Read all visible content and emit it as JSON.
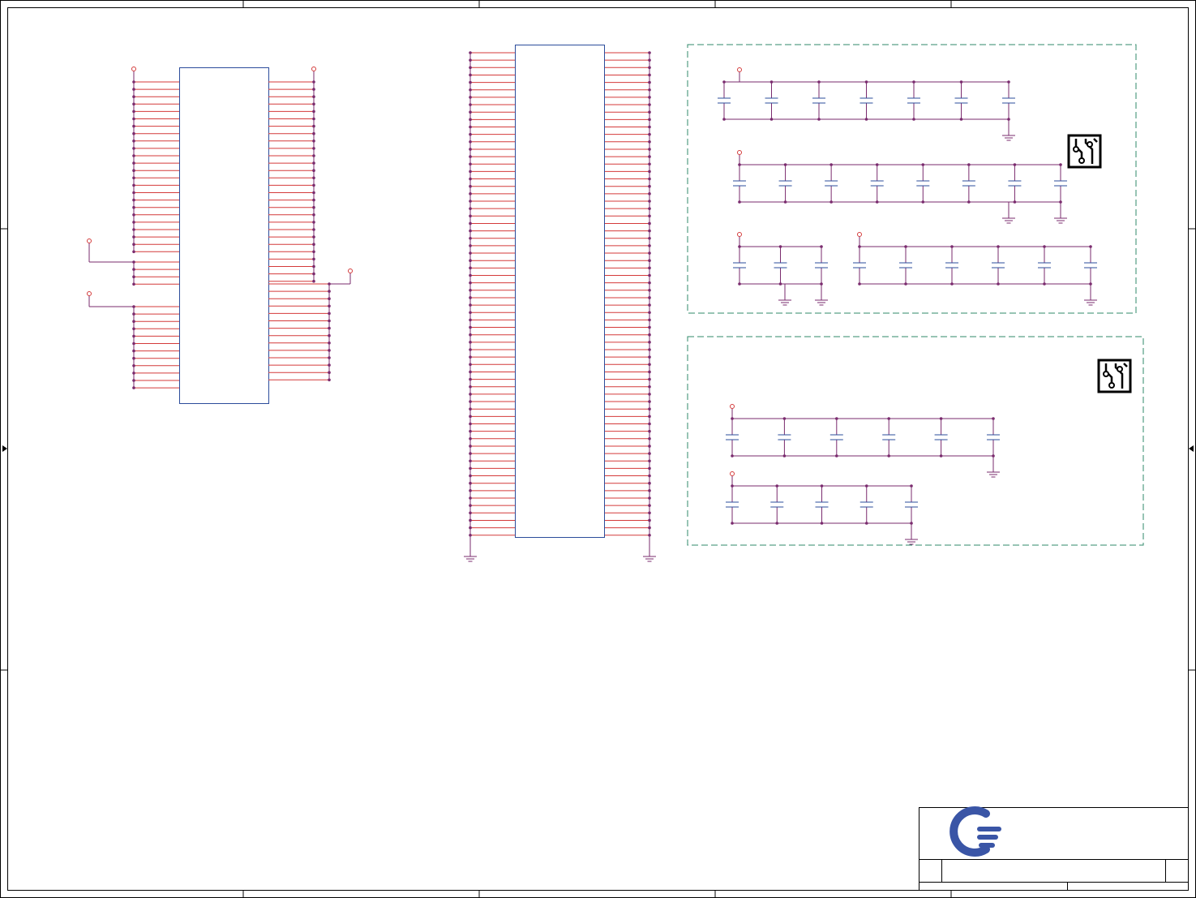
{
  "colors": {
    "frame": "#000000",
    "wire": "#7a2b6e",
    "pin": "#d43a3a",
    "part": "#2b4c9b",
    "box": "#2f8a6a",
    "logo": "#3a55a6",
    "ic": "#000000"
  },
  "drawing": {
    "chip_left_pins_top_group": 24,
    "chip_left_pins_mid_group": 4,
    "chip_left_pins_bottom_group": 12,
    "chip_right_pins_top_group": 28,
    "chip_right_pins_bottom_group": 14,
    "connector_pins_per_side": 66
  },
  "decoupling_blocks": [
    {
      "name": "block-1",
      "rows": [
        {
          "caps": 7,
          "grounds": 1
        },
        {
          "caps": 8,
          "grounds": 2
        },
        {
          "caps": 3,
          "grounds": 2
        },
        {
          "caps": 6,
          "grounds": 1
        }
      ]
    },
    {
      "name": "block-2",
      "rows": [
        {
          "caps": 6,
          "grounds": 1
        },
        {
          "caps": 5,
          "grounds": 1
        }
      ]
    }
  ],
  "icons": {
    "pcb": "pcb-icon",
    "logo": "company-logo-icon"
  }
}
